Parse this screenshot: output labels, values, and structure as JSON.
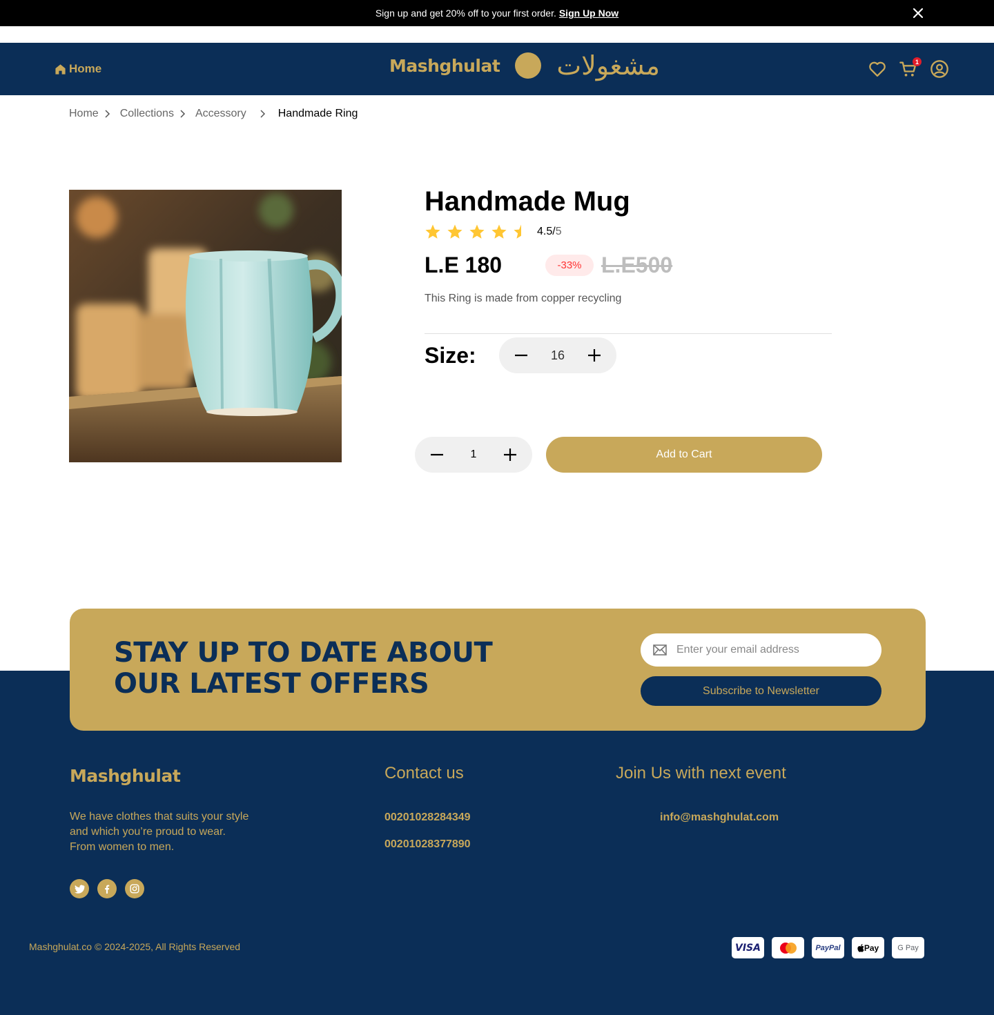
{
  "promo": {
    "text": "Sign up and get 20% off to your first order.",
    "link": "Sign Up Now"
  },
  "header": {
    "home_label": "Home",
    "logo_latin": "Mashghulat",
    "logo_arabic": "مشغولات",
    "cart_count": "1"
  },
  "breadcrumb": [
    "Home",
    "Collections",
    "Accessory",
    "Handmade Ring"
  ],
  "product": {
    "title": "Handmade Mug",
    "rating": "4.5/",
    "rating_max": "5",
    "rating_value": 4.5,
    "price": "L.E 180",
    "discount": "-33%",
    "old_price": "L.E500",
    "description": "This Ring is made from copper recycling",
    "size_label": "Size:",
    "size_value": "16",
    "quantity": "1",
    "add_to_cart": "Add to Cart"
  },
  "newsletter": {
    "title_line1": "STAY UP TO DATE ABOUT",
    "title_line2": "OUR LATEST OFFERS",
    "email_placeholder": "Enter your email address",
    "subscribe_label": "Subscribe to Newsletter"
  },
  "footer": {
    "logo": "Mashghulat",
    "about": "We have clothes that suits your style and which you’re proud to wear. From women to men.",
    "contact_heading": "Contact us",
    "phones": [
      "00201028284349",
      "00201028377890"
    ],
    "event_heading": "Join Us with next event",
    "email": "info@mashghulat.com",
    "copyright": "Mashghulat.co © 2024-2025, All Rights Reserved",
    "payments": [
      "VISA",
      "PayPal",
      "Pay",
      "G Pay"
    ]
  },
  "colors": {
    "navy": "#0b2e57",
    "gold": "#c8a85a",
    "star": "#ffc633",
    "discount_red": "#ff3333"
  },
  "icons": [
    "close-icon",
    "home-icon",
    "heart-icon",
    "cart-icon",
    "user-circle-icon",
    "chevron-right-icon",
    "star-icon",
    "minus-icon",
    "plus-icon",
    "mail-icon",
    "twitter-icon",
    "facebook-icon",
    "instagram-icon"
  ]
}
